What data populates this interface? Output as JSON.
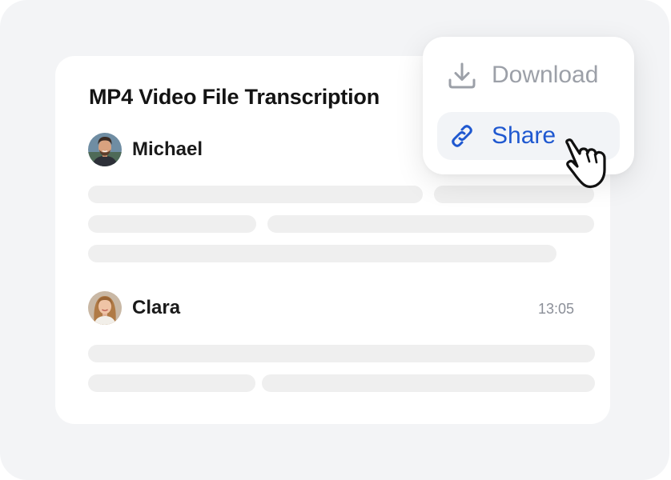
{
  "card": {
    "title": "MP4 Video File Transcription",
    "speakers": [
      {
        "name": "Michael",
        "avatar_icon": "man-avatar-icon",
        "time": ""
      },
      {
        "name": "Clara",
        "avatar_icon": "woman-avatar-icon",
        "time": "13:05"
      }
    ]
  },
  "menu": {
    "items": [
      {
        "label": "Download",
        "icon": "download-icon",
        "state": "default"
      },
      {
        "label": "Share",
        "icon": "link-icon",
        "state": "hovered"
      }
    ]
  },
  "cursor_icon": "hand-pointer-icon",
  "colors": {
    "background": "#f3f4f6",
    "card": "#ffffff",
    "placeholder_line": "#efefef",
    "share_accent": "#1f58d0",
    "download_muted": "#9ca0a8",
    "hover_bg": "#f2f4f7"
  }
}
